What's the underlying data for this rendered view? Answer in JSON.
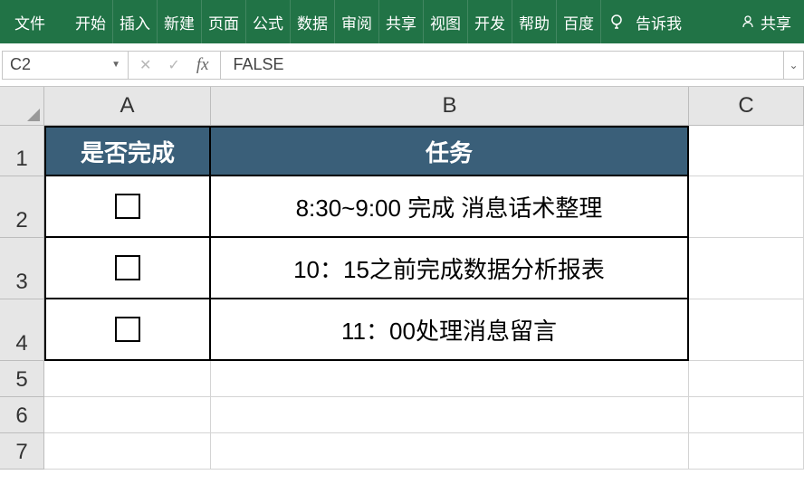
{
  "ribbon": {
    "file": "文件",
    "tabs": [
      "开始",
      "插入",
      "新建",
      "页面",
      "公式",
      "数据",
      "审阅",
      "共享",
      "视图",
      "开发",
      "帮助",
      "百度"
    ],
    "tell_me": "告诉我",
    "share": "共享"
  },
  "formula_bar": {
    "name_box": "C2",
    "value": "FALSE"
  },
  "columns": [
    "A",
    "B",
    "C"
  ],
  "rows": [
    "1",
    "2",
    "3",
    "4",
    "5",
    "6",
    "7"
  ],
  "table": {
    "headers": {
      "A": "是否完成",
      "B": "任务"
    },
    "rows": [
      {
        "done": false,
        "task": "8:30~9:00 完成 消息话术整理"
      },
      {
        "done": false,
        "task": "10：15之前完成数据分析报表"
      },
      {
        "done": false,
        "task": "11：00处理消息留言"
      }
    ]
  }
}
